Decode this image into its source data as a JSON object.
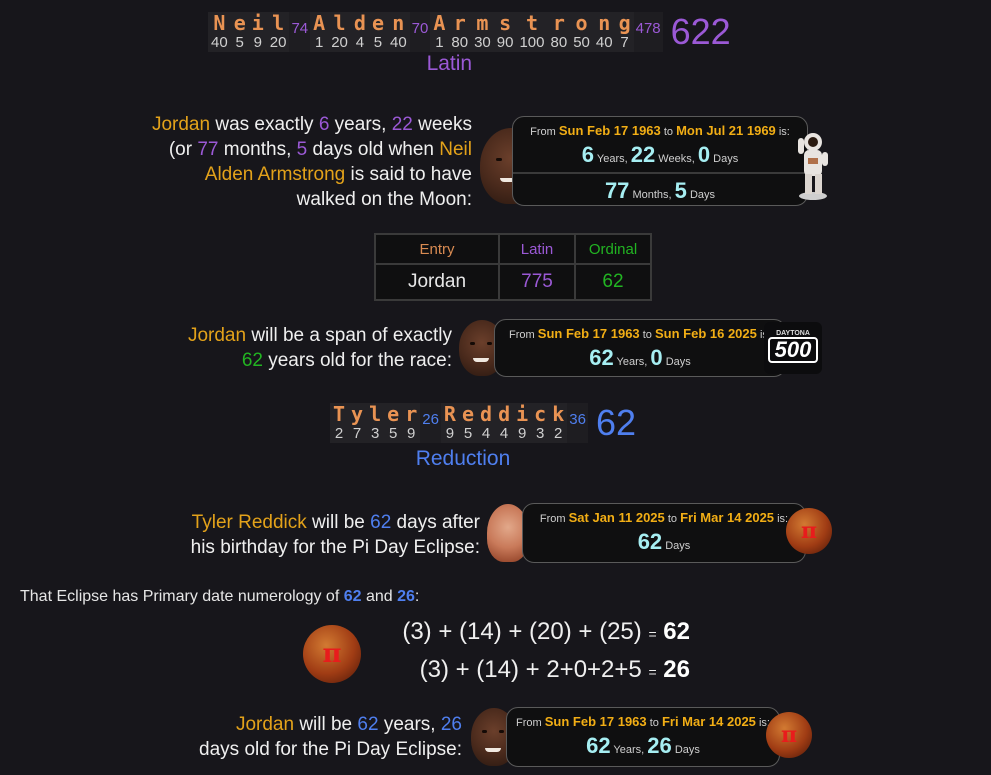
{
  "colors": {
    "background": "#17161b",
    "name_highlight": "#e3a21a",
    "latin": "#9b59d6",
    "ordinal": "#22b422",
    "reduction": "#4f7fef",
    "date_value": "#a6eef2",
    "cipher_letter": "#e99353"
  },
  "cipher1": {
    "words": [
      {
        "letters": [
          {
            "ch": "N",
            "v": "40"
          },
          {
            "ch": "e",
            "v": "5"
          },
          {
            "ch": "i",
            "v": "9"
          },
          {
            "ch": "l",
            "v": "20"
          }
        ],
        "sum": "74"
      },
      {
        "letters": [
          {
            "ch": "A",
            "v": "1"
          },
          {
            "ch": "l",
            "v": "20"
          },
          {
            "ch": "d",
            "v": "4"
          },
          {
            "ch": "e",
            "v": "5"
          },
          {
            "ch": "n",
            "v": "40"
          }
        ],
        "sum": "70"
      },
      {
        "letters": [
          {
            "ch": "A",
            "v": "1"
          },
          {
            "ch": "r",
            "v": "80"
          },
          {
            "ch": "m",
            "v": "30"
          },
          {
            "ch": "s",
            "v": "90"
          },
          {
            "ch": "t",
            "v": "100"
          },
          {
            "ch": "r",
            "v": "80"
          },
          {
            "ch": "o",
            "v": "50"
          },
          {
            "ch": "n",
            "v": "40"
          },
          {
            "ch": "g",
            "v": "7"
          }
        ],
        "sum": "478"
      }
    ],
    "total": "622",
    "name": "Latin"
  },
  "block1": {
    "subject": "Jordan",
    "t1": " was exactly ",
    "n1": "6",
    "t2": " years, ",
    "n2": "22",
    "t3": " weeks (or ",
    "n3": "77",
    "t4": " months, ",
    "n4": "5",
    "t5": " days old when ",
    "target": "Neil Alden Armstrong",
    "t6": " is said to have walked on the Moon:",
    "box": {
      "from_label": "From",
      "from": "Sun Feb 17 1963",
      "to_label": "to",
      "to": "Mon Jul 21 1969",
      "is_label": "is:",
      "row1": [
        {
          "v": "6",
          "u": "Years,"
        },
        {
          "v": "22",
          "u": "Weeks,"
        },
        {
          "v": "0",
          "u": "Days"
        }
      ],
      "row2": [
        {
          "v": "77",
          "u": "Months,"
        },
        {
          "v": "5",
          "u": "Days"
        }
      ]
    }
  },
  "table": {
    "headers": [
      "Entry",
      "Latin",
      "Ordinal"
    ],
    "row": [
      "Jordan",
      "775",
      "62"
    ]
  },
  "block2": {
    "subject": "Jordan",
    "t1": " will be a span of exactly",
    "n1": "62",
    "t2": " years old for the race:",
    "box": {
      "from_label": "From",
      "from": "Sun Feb 17 1963",
      "to_label": "to",
      "to": "Sun Feb 16 2025",
      "is_label": "is:",
      "row1": [
        {
          "v": "62",
          "u": "Years,"
        },
        {
          "v": "0",
          "u": "Days"
        }
      ]
    },
    "logo_text": "500",
    "logo_sub": "DAYTONA"
  },
  "cipher2": {
    "words": [
      {
        "letters": [
          {
            "ch": "T",
            "v": "2"
          },
          {
            "ch": "y",
            "v": "7"
          },
          {
            "ch": "l",
            "v": "3"
          },
          {
            "ch": "e",
            "v": "5"
          },
          {
            "ch": "r",
            "v": "9"
          }
        ],
        "sum": "26"
      },
      {
        "letters": [
          {
            "ch": "R",
            "v": "9"
          },
          {
            "ch": "e",
            "v": "5"
          },
          {
            "ch": "d",
            "v": "4"
          },
          {
            "ch": "d",
            "v": "4"
          },
          {
            "ch": "i",
            "v": "9"
          },
          {
            "ch": "c",
            "v": "3"
          },
          {
            "ch": "k",
            "v": "2"
          }
        ],
        "sum": "36"
      }
    ],
    "total": "62",
    "name": "Reduction"
  },
  "block3": {
    "subject": "Tyler Reddick",
    "t1": " will be ",
    "n1": "62",
    "t2": " days after",
    "t3": "his birthday for the Pi Day Eclipse:",
    "box": {
      "from_label": "From",
      "from": "Sat Jan 11 2025",
      "to_label": "to",
      "to": "Fri Mar 14 2025",
      "is_label": "is:",
      "row1": [
        {
          "v": "62",
          "u": "Days"
        }
      ]
    }
  },
  "numerology": {
    "t1": "That Eclipse has Primary date numerology of ",
    "n1": "62",
    "t2": " and ",
    "n2": "26",
    "t3": ":",
    "eq1_expr": "(3) + (14) + (20) + (25)",
    "eq1_result": "62",
    "eq2_expr": "(3) + (14) + 2+0+2+5",
    "eq2_result": "26",
    "equals": "=",
    "pi": "π"
  },
  "block4": {
    "subject": "Jordan",
    "t1": " will be ",
    "n1": "62",
    "t2": " years, ",
    "n2": "26",
    "t3": "days old for the Pi Day Eclipse:",
    "box": {
      "from_label": "From",
      "from": "Sun Feb 17 1963",
      "to_label": "to",
      "to": "Fri Mar 14 2025",
      "is_label": "is:",
      "row1": [
        {
          "v": "62",
          "u": "Years,"
        },
        {
          "v": "26",
          "u": "Days"
        }
      ]
    }
  }
}
